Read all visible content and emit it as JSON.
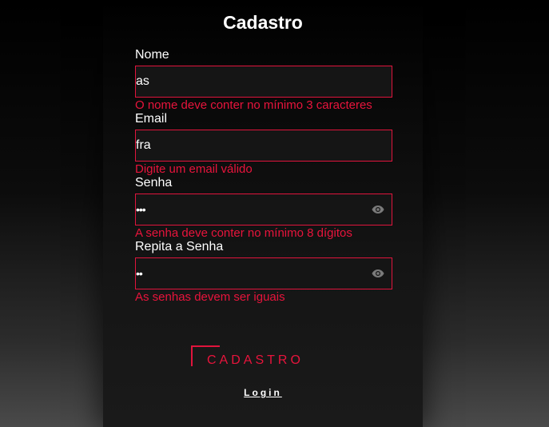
{
  "form": {
    "title": "Cadastro",
    "fields": [
      {
        "label": "Nome",
        "value": "as",
        "type": "text",
        "error": "O nome deve conter no mínimo 3 caracteres"
      },
      {
        "label": "Email",
        "value": "fra",
        "type": "text",
        "error": "Digite um email válido"
      },
      {
        "label": "Senha",
        "value": "abc",
        "type": "password",
        "error": "A senha deve conter no mínimo 8 dígitos",
        "icon": "eye-icon"
      },
      {
        "label": "Repita a Senha",
        "value": "ab",
        "type": "password",
        "error": "As senhas devem ser iguais",
        "icon": "eye-icon"
      }
    ],
    "submit_label": "CADASTRO",
    "login_link": "Login"
  },
  "colors": {
    "accent": "#e0143c",
    "text": "#ffffff",
    "card_background": "#151515"
  }
}
